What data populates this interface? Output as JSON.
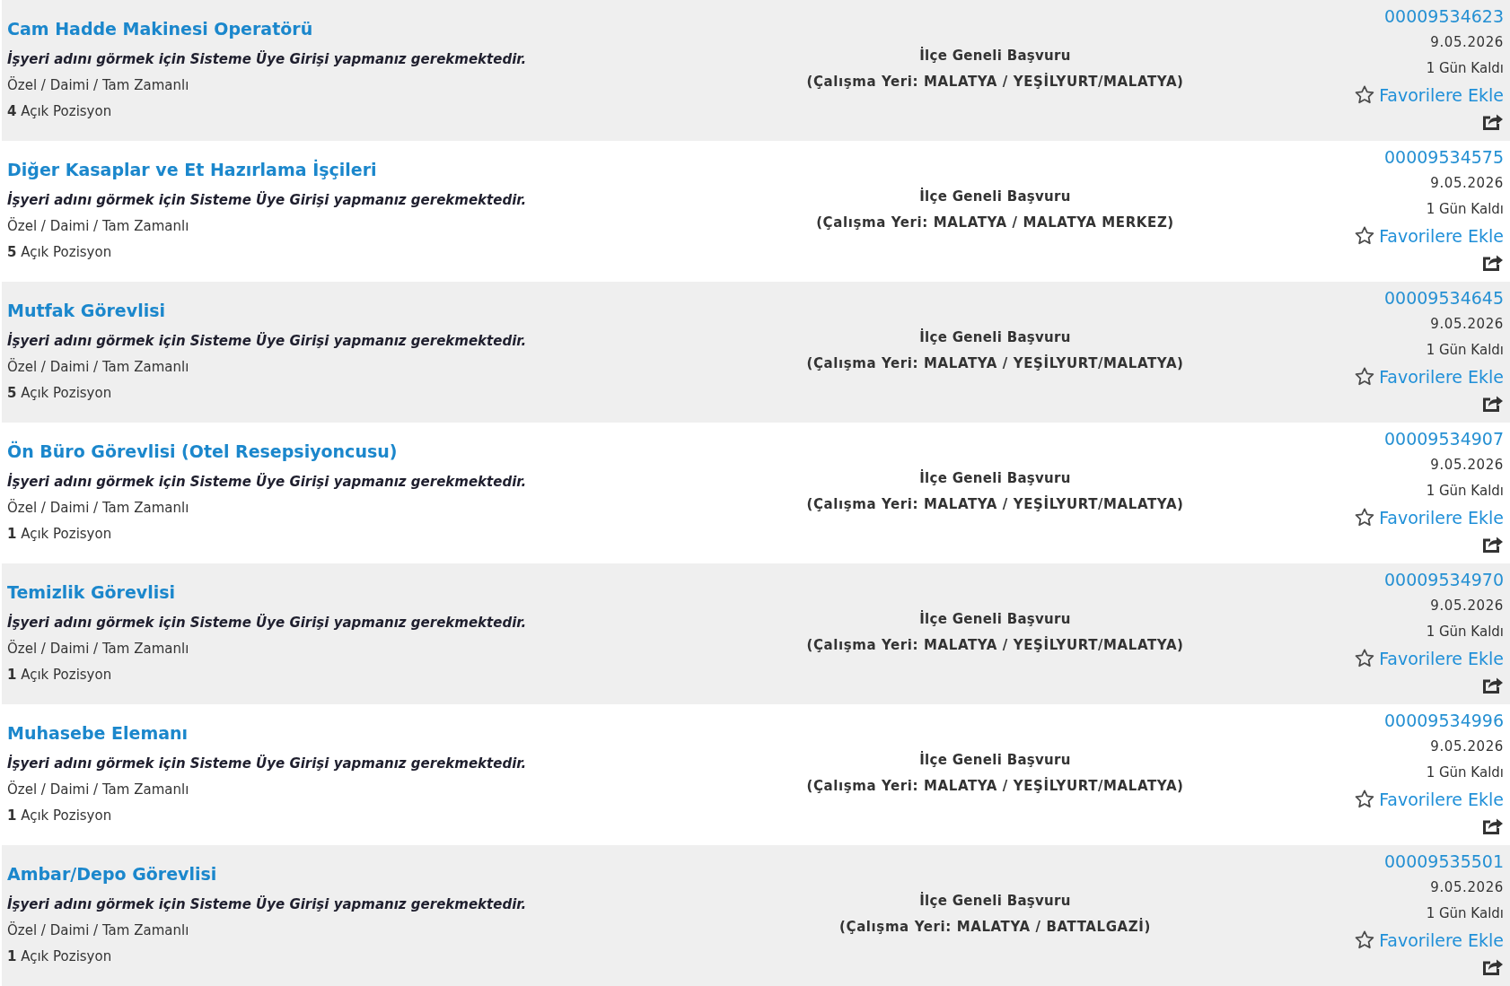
{
  "jobs": [
    {
      "title": "Cam Hadde Makinesi Operatörü",
      "employer_note": "İşyeri adını görmek için Sisteme Üye Girişi yapmanız gerekmektedir.",
      "employment_type": "Özel / Daimi / Tam Zamanlı",
      "open_positions": "**4** Açık Pozisyon",
      "scope": "İlçe Geneli Başvuru",
      "workplace": "(Çalışma Yeri: MALATYA / YEŞİLYURT/MALATYA)",
      "listing_no": "00009534623",
      "date": "9.05.2026",
      "remaining": "1 Gün Kaldı",
      "favorite_label": "Favorilere Ekle"
    },
    {
      "title": "Diğer Kasaplar ve Et Hazırlama İşçileri",
      "employer_note": "İşyeri adını görmek için Sisteme Üye Girişi yapmanız gerekmektedir.",
      "employment_type": "Özel / Daimi / Tam Zamanlı",
      "open_positions": "**5** Açık Pozisyon",
      "scope": "İlçe Geneli Başvuru",
      "workplace": "(Çalışma Yeri: MALATYA / MALATYA MERKEZ)",
      "listing_no": "00009534575",
      "date": "9.05.2026",
      "remaining": "1 Gün Kaldı",
      "favorite_label": "Favorilere Ekle"
    },
    {
      "title": "Mutfak Görevlisi",
      "employer_note": "İşyeri adını görmek için Sisteme Üye Girişi yapmanız gerekmektedir.",
      "employment_type": "Özel / Daimi / Tam Zamanlı",
      "open_positions": "**5** Açık Pozisyon",
      "scope": "İlçe Geneli Başvuru",
      "workplace": "(Çalışma Yeri: MALATYA / YEŞİLYURT/MALATYA)",
      "listing_no": "00009534645",
      "date": "9.05.2026",
      "remaining": "1 Gün Kaldı",
      "favorite_label": "Favorilere Ekle"
    },
    {
      "title": "Ön Büro Görevlisi (Otel Resepsiyoncusu)",
      "employer_note": "İşyeri adını görmek için Sisteme Üye Girişi yapmanız gerekmektedir.",
      "employment_type": "Özel / Daimi / Tam Zamanlı",
      "open_positions": "**1** Açık Pozisyon",
      "scope": "İlçe Geneli Başvuru",
      "workplace": "(Çalışma Yeri: MALATYA / YEŞİLYURT/MALATYA)",
      "listing_no": "00009534907",
      "date": "9.05.2026",
      "remaining": "1 Gün Kaldı",
      "favorite_label": "Favorilere Ekle"
    },
    {
      "title": "Temizlik Görevlisi",
      "employer_note": "İşyeri adını görmek için Sisteme Üye Girişi yapmanız gerekmektedir.",
      "employment_type": "Özel / Daimi / Tam Zamanlı",
      "open_positions": "**1** Açık Pozisyon",
      "scope": "İlçe Geneli Başvuru",
      "workplace": "(Çalışma Yeri: MALATYA / YEŞİLYURT/MALATYA)",
      "listing_no": "00009534970",
      "date": "9.05.2026",
      "remaining": "1 Gün Kaldı",
      "favorite_label": "Favorilere Ekle"
    },
    {
      "title": "Muhasebe Elemanı",
      "employer_note": "İşyeri adını görmek için Sisteme Üye Girişi yapmanız gerekmektedir.",
      "employment_type": "Özel / Daimi / Tam Zamanlı",
      "open_positions": "**1** Açık Pozisyon",
      "scope": "İlçe Geneli Başvuru",
      "workplace": "(Çalışma Yeri: MALATYA / YEŞİLYURT/MALATYA)",
      "listing_no": "00009534996",
      "date": "9.05.2026",
      "remaining": "1 Gün Kaldı",
      "favorite_label": "Favorilere Ekle"
    },
    {
      "title": "Ambar/Depo Görevlisi",
      "employer_note": "İşyeri adını görmek için Sisteme Üye Girişi yapmanız gerekmektedir.",
      "employment_type": "Özel / Daimi / Tam Zamanlı",
      "open_positions": "**1** Açık Pozisyon",
      "scope": "İlçe Geneli Başvuru",
      "workplace": "(Çalışma Yeri: MALATYA / BATTALGAZİ)",
      "listing_no": "00009535501",
      "date": "9.05.2026",
      "remaining": "1 Gün Kaldı",
      "favorite_label": "Favorilere Ekle"
    }
  ]
}
